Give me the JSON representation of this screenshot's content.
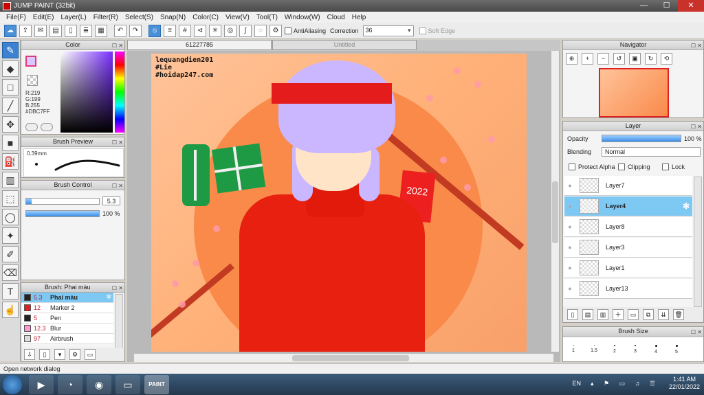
{
  "window": {
    "title": "JUMP PAINT (32bit)",
    "min": "—",
    "max": "☐",
    "close": "✕"
  },
  "menu": [
    "File(F)",
    "Edit(E)",
    "Layer(L)",
    "Filter(R)",
    "Select(S)",
    "Snap(N)",
    "Color(C)",
    "View(V)",
    "Tool(T)",
    "Window(W)",
    "Cloud",
    "Help"
  ],
  "toolbar": {
    "antialias_label": "AntiAliasing",
    "correction_label": "Correction",
    "correction_value": "36",
    "soft_edge_label": "Soft Edge"
  },
  "color": {
    "title": "Color",
    "r": "R:219",
    "g": "G:199",
    "b": "B:255",
    "hex": "#DBC7FF"
  },
  "brush_preview": {
    "title": "Brush Preview",
    "size": "0.39mm"
  },
  "brush_control": {
    "title": "Brush Control",
    "size_value": "5.3",
    "opacity_value": "100 %"
  },
  "brush_list": {
    "title": "Brush: Phai màu",
    "items": [
      {
        "size": "5.3",
        "name": "Phai màu",
        "color": "#222222"
      },
      {
        "size": "12",
        "name": "Marker 2",
        "color": "#e02020"
      },
      {
        "size": "5",
        "name": "Pen",
        "color": "#222222"
      },
      {
        "size": "12.3",
        "name": "Blur",
        "color": "#ff9ad8"
      },
      {
        "size": "97",
        "name": "Airbrush",
        "color": "#dddddd"
      }
    ]
  },
  "tabs": [
    {
      "label": "61227785"
    },
    {
      "label": "Untitled"
    }
  ],
  "artwork": {
    "watermark_1": "lequangdien201",
    "watermark_2": "#Lie",
    "watermark_3": "#hoidap247.com",
    "envelope_text": "2022"
  },
  "navigator": {
    "title": "Navigator"
  },
  "layer": {
    "title": "Layer",
    "opacity_label": "Opacity",
    "opacity_value": "100 %",
    "blending_label": "Blending",
    "blending_value": "Normal",
    "protect_alpha": "Protect Alpha",
    "clipping": "Clipping",
    "lock": "Lock",
    "items": [
      {
        "name": "Layer7"
      },
      {
        "name": "Layer4"
      },
      {
        "name": "Layer8"
      },
      {
        "name": "Layer3"
      },
      {
        "name": "Layer1"
      },
      {
        "name": "Layer13"
      }
    ]
  },
  "brush_size": {
    "title": "Brush Size",
    "sizes": [
      "1",
      "1.5",
      "2",
      "3",
      "4",
      "5"
    ]
  },
  "status": "Open network dialog",
  "taskbar": {
    "lang": "EN",
    "time": "1:41 AM",
    "date": "22/01/2022",
    "paint_label": "PAINT"
  }
}
